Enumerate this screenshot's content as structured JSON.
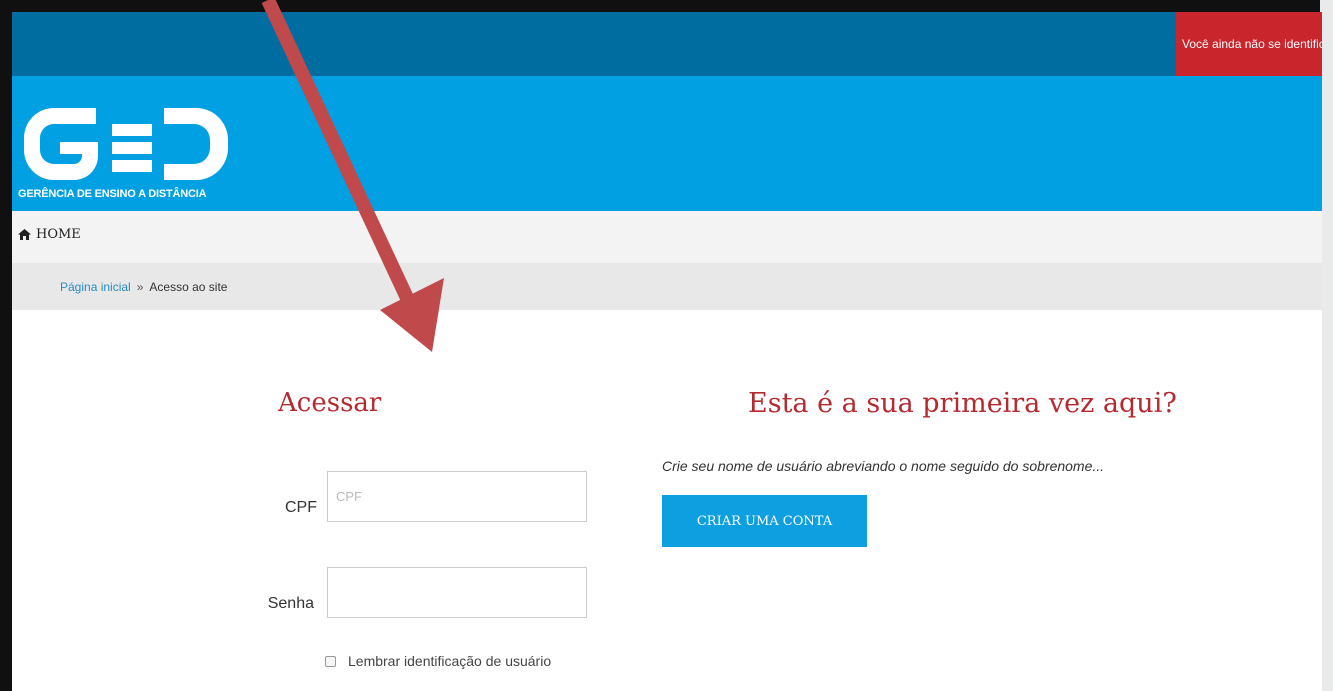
{
  "top_bar": {
    "login_status": "Você ainda não se identificou"
  },
  "header": {
    "logo_text": "GED",
    "logo_subtitle": "GERÊNCIA DE ENSINO A DISTÂNCIA"
  },
  "nav": {
    "home_icon": "home-icon",
    "home_label": "HOME"
  },
  "breadcrumb": {
    "home": "Página inicial",
    "separator": "»",
    "current": "Acesso ao site"
  },
  "login_form": {
    "title": "Acessar",
    "cpf_label": "CPF",
    "cpf_placeholder": "CPF",
    "cpf_value": "",
    "password_label": "Senha",
    "password_value": "",
    "remember_label": "Lembrar identificação de usuário",
    "remember_checked": false
  },
  "signup": {
    "title": "Esta é a sua primeira vez aqui?",
    "description": "Crie seu nome de usuário abreviando o nome seguido do sobrenome...",
    "button_label": "CRIAR UMA CONTA"
  },
  "colors": {
    "top_bar": "#006da0",
    "header": "#00a0e2",
    "status_badge": "#c8252c",
    "title_red": "#b52a2f",
    "button_blue": "#0d9fdf",
    "annotation_arrow": "#c0494b"
  },
  "annotation": {
    "icon": "arrow-annotation"
  }
}
